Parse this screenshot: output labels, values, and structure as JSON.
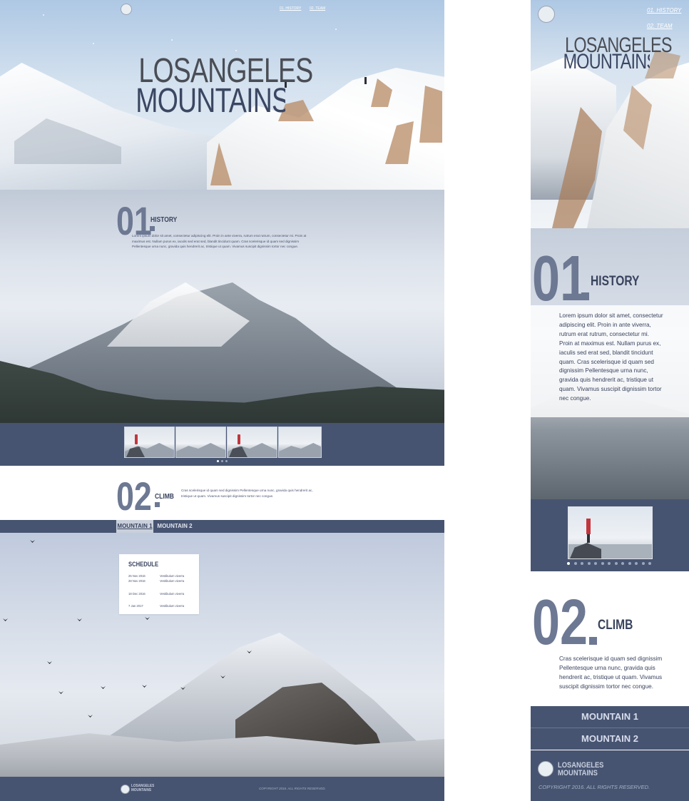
{
  "site": {
    "logo_top": "LOSANGELES",
    "logo_bottom": "MOUNTAINS"
  },
  "nav": {
    "history": "01. HISTORY",
    "team": "02. TEAM"
  },
  "hero": {
    "title_line1": "LOSANGELES",
    "title_line2": "MOUNTAINS"
  },
  "history": {
    "number": "01",
    "label": "HISTORY",
    "body_desktop": "Lorem ipsum dolor sit amet, consectetur adipiscing elit. Proin in ante viverra, rutrum erat rutrum, consectetur mi. Proin at maximus est. Nullam purus ex, iaculis sed erat sed, blandit tincidunt quam. Cras scelerisque id quam sed dignissim Pellentesque urna nunc, gravida quis hendrerit ac, tristique ut quam. Vivamus suscipit dignissim tortor nec congue.",
    "body_mobile": "Lorem ipsum dolor sit amet, consectetur adipiscing elit. Proin in ante viverra, rutrum erat rutrum, consectetur mi. Proin at maximus est. Nullam purus ex, iaculis sed erat sed, blandit tincidunt quam. Cras scelerisque id quam sed dignissim Pellentesque urna nunc, gravida quis hendrerit ac, tristique ut quam. Vivamus suscipit dignissim tortor nec congue.",
    "gallery_dots_desktop": 3,
    "gallery_dots_mobile": 13
  },
  "climb": {
    "number": "02",
    "label": "CLIMB",
    "body": "Cras scelerisque id quam sed dignissim Pellentesque urna nunc, gravida quis hendrerit ac, tristique ut quam. Vivamus suscipit dignissim tortor nec congue.",
    "tabs": [
      "MOUNTAIN 1",
      "MOUNTAIN 2"
    ],
    "active_tab": "MOUNTAIN 1"
  },
  "schedule": {
    "title": "SCHEDULE",
    "rows": [
      {
        "date": "25 Nov 2016",
        "place": "Vestibulum viverra"
      },
      {
        "date": "28 Nov 2016",
        "place": "Vestibulum viverra"
      },
      {
        "date": "18 Dec 2016",
        "place": "Vestibulum viverra"
      },
      {
        "date": "7 Jan 2017",
        "place": "Vestibulum viverra"
      }
    ]
  },
  "footer": {
    "copyright": "COPYRIGHT 2016. ALL RIGHTS RESERVED."
  },
  "colors": {
    "navy": "#475471",
    "slate_number": "#6d7893",
    "text_dark": "#39435e",
    "tab_active": "#c9d0dc"
  },
  "icons": [
    "logo-mountain-icon",
    "gallery-dot-icon"
  ]
}
